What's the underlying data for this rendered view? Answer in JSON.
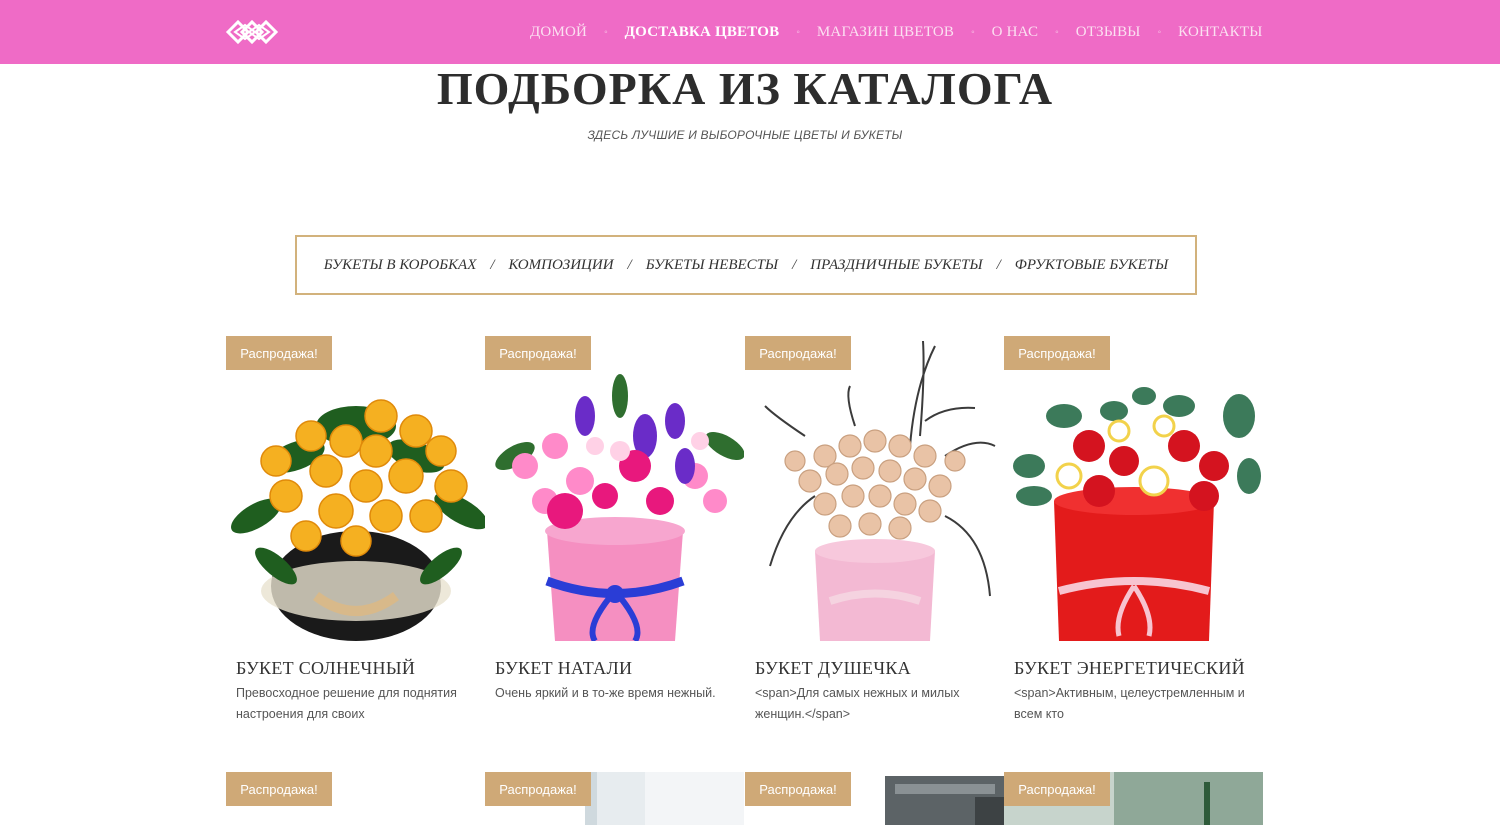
{
  "header": {
    "logo_icon": "interlocked-diamonds-logo",
    "nav": [
      {
        "label": "ДОМОЙ",
        "active": false
      },
      {
        "label": "ДОСТАВКА ЦВЕТОВ",
        "active": true
      },
      {
        "label": "МАГАЗИН ЦВЕТОВ",
        "active": false
      },
      {
        "label": "О НАС",
        "active": false
      },
      {
        "label": "ОТЗЫВЫ",
        "active": false
      },
      {
        "label": "КОНТАКТЫ",
        "active": false
      }
    ],
    "nav_separator": "◦"
  },
  "main": {
    "title": "ПОДБОРКА ИЗ КАТАЛОГА",
    "subtitle": "ЗДЕСЬ ЛУЧШИЕ И ВЫБОРОЧНЫЕ ЦВЕТЫ И БУКЕТЫ",
    "categories": [
      "БУКЕТЫ В КОРОБКАХ",
      "КОМПОЗИЦИИ",
      "БУКЕТЫ НЕВЕСТЫ",
      "ПРАЗДНИЧНЫЕ БУКЕТЫ",
      "ФРУКТОВЫЕ БУКЕТЫ"
    ],
    "category_separator": "/",
    "products": [
      {
        "badge": "Распродажа!",
        "name": "БУКЕТ СОЛНЕЧНЫЙ",
        "desc": "Превосходное решение для поднятия настроения для своих",
        "image": "yellow-roses-bouquet"
      },
      {
        "badge": "Распродажа!",
        "name": "БУКЕТ НАТАЛИ",
        "desc": "Очень яркий и в то-же время нежный.",
        "image": "pink-purple-box-bouquet"
      },
      {
        "badge": "Распродажа!",
        "name": "БУКЕТ ДУШЕЧКА",
        "desc": "<span>Для самых нежных и милых женщин.</span>",
        "image": "peach-roses-box-bouquet"
      },
      {
        "badge": "Распродажа!",
        "name": "БУКЕТ ЭНЕРГЕТИЧЕСКИЙ",
        "desc": "<span>Активным, целеустремленным и всем кто",
        "image": "red-box-bouquet"
      }
    ],
    "row2_badges": [
      "Распродажа!",
      "Распродажа!",
      "Распродажа!",
      "Распродажа!"
    ]
  },
  "colors": {
    "header_bg": "#ef6bc6",
    "badge_bg": "#cfa977",
    "category_border": "#d2b27c"
  }
}
